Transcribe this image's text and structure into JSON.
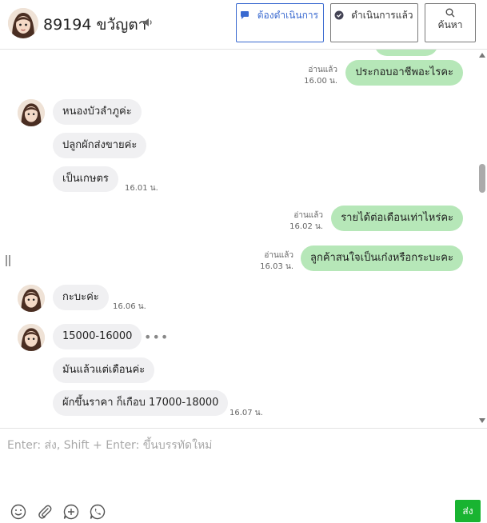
{
  "header": {
    "title": "89194 ขวัญตา",
    "buttons": {
      "todo": "ต้องดำเนินการ",
      "done": "ดำเนินการแล้ว",
      "search": "ค้นหา"
    }
  },
  "messages": [
    {
      "side": "out",
      "text": "ประกอบอาชีพอะไรคะ",
      "read": "อ่านแล้ว",
      "time": "16.00 น."
    },
    {
      "side": "in",
      "text": "หนองบัวลำภูค่ะ",
      "time": ""
    },
    {
      "side": "in",
      "text": "ปลูกผักส่งขายค่ะ",
      "time": ""
    },
    {
      "side": "in",
      "text": "เป็นเกษตร",
      "time": "16.01 น."
    },
    {
      "side": "out",
      "text": "รายได้ต่อเดือนเท่าไหร่คะ",
      "read": "อ่านแล้ว",
      "time": "16.02 น."
    },
    {
      "side": "out",
      "text": "ลูกค้าสนใจเป็นเก๋งหรือกระบะคะ",
      "read": "อ่านแล้ว",
      "time": "16.03 น."
    },
    {
      "side": "in",
      "text": "กะบะค่ะ",
      "time": "16.06 น."
    },
    {
      "side": "in",
      "text": "15000-16000",
      "time": ""
    },
    {
      "side": "in",
      "text": "มันแล้วแต่เดือนค่ะ",
      "time": ""
    },
    {
      "side": "in",
      "text": "ผักขึ้นราคา ก็เกือบ 17000-18000",
      "time": "16.07 น."
    }
  ],
  "more_icon": "•••",
  "composer": {
    "placeholder": "Enter: ส่ง, Shift + Enter: ขึ้นบรรทัดใหม่",
    "send_label": "ส่ง"
  },
  "colors": {
    "outgoing_bubble": "#b6e7b8",
    "incoming_bubble": "#f0f0f2",
    "primary_blue": "#3a6ad0",
    "send_green": "#19b431"
  }
}
